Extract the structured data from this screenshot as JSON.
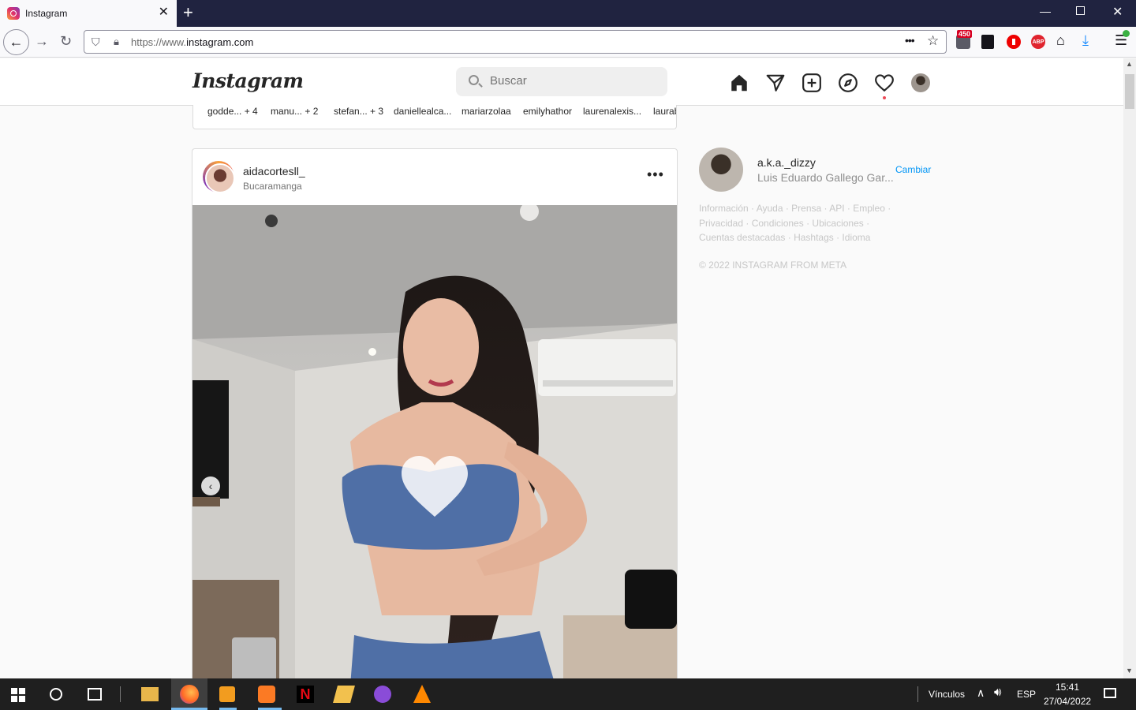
{
  "browser": {
    "tab_title": "Instagram",
    "url_prefix": "https://www.",
    "url_host": "instagram.com",
    "extension_badge": "450",
    "page_actions_icon": "•••"
  },
  "instagram": {
    "logo": "Instagram",
    "search_placeholder": "Buscar",
    "stories": [
      "godde... + 4",
      "manu... + 2",
      "stefan... + 3",
      "daniellealca...",
      "mariarzolaa",
      "emilyhathor",
      "laurenalexis...",
      "laurab"
    ],
    "post": {
      "username": "aidacortesll_",
      "location": "Bucaramanga",
      "more_icon": "•••"
    },
    "sidebar": {
      "username": "a.k.a._dizzy",
      "full_name": "Luis Eduardo Gallego Gar...",
      "switch_label": "Cambiar",
      "links_line1": "Información · Ayuda · Prensa · API · Empleo ·",
      "links_line2": "Privacidad · Condiciones · Ubicaciones ·",
      "links_line3": "Cuentas destacadas · Hashtags · Idioma",
      "copyright": "© 2022 INSTAGRAM FROM META"
    }
  },
  "taskbar": {
    "links_label": "Vínculos",
    "language": "ESP",
    "time": "15:41",
    "date": "27/04/2022"
  },
  "colors": {
    "titlebar": "#202340",
    "ig_link_blue": "#0095f6",
    "notification_red": "#ed4956"
  }
}
